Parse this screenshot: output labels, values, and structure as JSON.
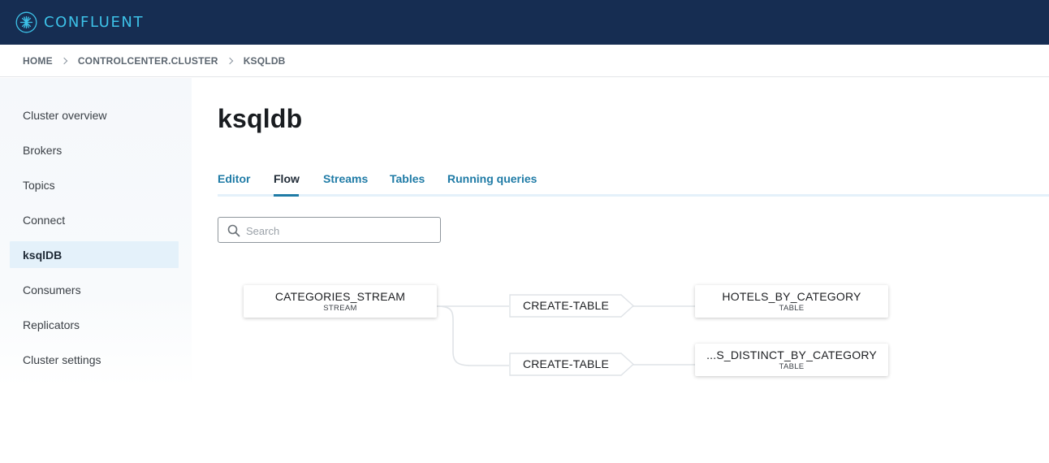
{
  "brand": {
    "name": "CONFLUENT",
    "icon": "confluent-logo-icon",
    "color": "#3dc2e8"
  },
  "breadcrumb": [
    "HOME",
    "CONTROLCENTER.CLUSTER",
    "KSQLDB"
  ],
  "sidebar": {
    "items": [
      {
        "label": "Cluster overview",
        "active": false
      },
      {
        "label": "Brokers",
        "active": false
      },
      {
        "label": "Topics",
        "active": false
      },
      {
        "label": "Connect",
        "active": false
      },
      {
        "label": "ksqlDB",
        "active": true
      },
      {
        "label": "Consumers",
        "active": false
      },
      {
        "label": "Replicators",
        "active": false
      },
      {
        "label": "Cluster settings",
        "active": false
      }
    ]
  },
  "page": {
    "title": "ksqldb"
  },
  "tabs": [
    {
      "label": "Editor",
      "active": false
    },
    {
      "label": "Flow",
      "active": true
    },
    {
      "label": "Streams",
      "active": false
    },
    {
      "label": "Tables",
      "active": false
    },
    {
      "label": "Running queries",
      "active": false
    }
  ],
  "search": {
    "placeholder": "Search",
    "value": "",
    "icon": "search-icon"
  },
  "flow": {
    "source": {
      "name": "CATEGORIES_STREAM",
      "type": "STREAM"
    },
    "operations": [
      {
        "label": "CREATE-TABLE"
      },
      {
        "label": "CREATE-TABLE"
      }
    ],
    "targets": [
      {
        "name": "HOTELS_BY_CATEGORY",
        "type": "TABLE"
      },
      {
        "name": "...S_DISTINCT_BY_CATEGORY",
        "type": "TABLE"
      }
    ]
  },
  "colors": {
    "topbar": "#162d52",
    "accent": "#1f7ba6",
    "active_nav_bg": "#e4f1fa"
  }
}
